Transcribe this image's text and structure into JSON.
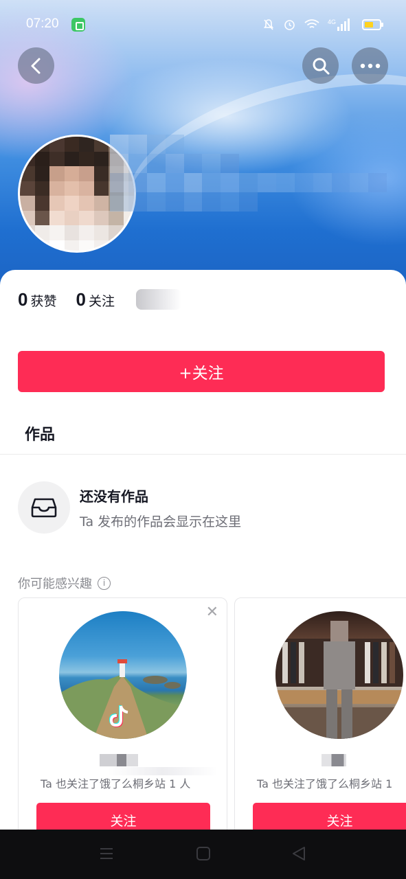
{
  "status_bar": {
    "time": "07:20",
    "network": "4G",
    "icons": [
      "app-icon",
      "mute-bell-icon",
      "alarm-icon",
      "wifi-icon",
      "signal-icon",
      "battery-icon"
    ]
  },
  "header": {
    "back_icon": "chevron-left-icon",
    "search_icon": "search-icon",
    "more_icon": "more-dots-icon"
  },
  "stats": {
    "likes_count": "0",
    "likes_label": "获赞",
    "following_count": "0",
    "following_label": "关注"
  },
  "follow_button_label": "+关注",
  "tabs": {
    "works_label": "作品"
  },
  "empty_state": {
    "title": "还没有作品",
    "subtitle": "Ta 发布的作品会显示在这里"
  },
  "recommendations": {
    "header": "你可能感兴趣",
    "cards": [
      {
        "mutual_text": "Ta 也关注了饿了么桐乡站 1 人",
        "follow_label": "关注"
      },
      {
        "mutual_text": "Ta 也关注了饿了么桐乡站 1",
        "follow_label": "关注"
      }
    ]
  },
  "colors": {
    "accent": "#fe2c55",
    "text_primary": "#161823",
    "text_secondary": "#6d6e76"
  }
}
